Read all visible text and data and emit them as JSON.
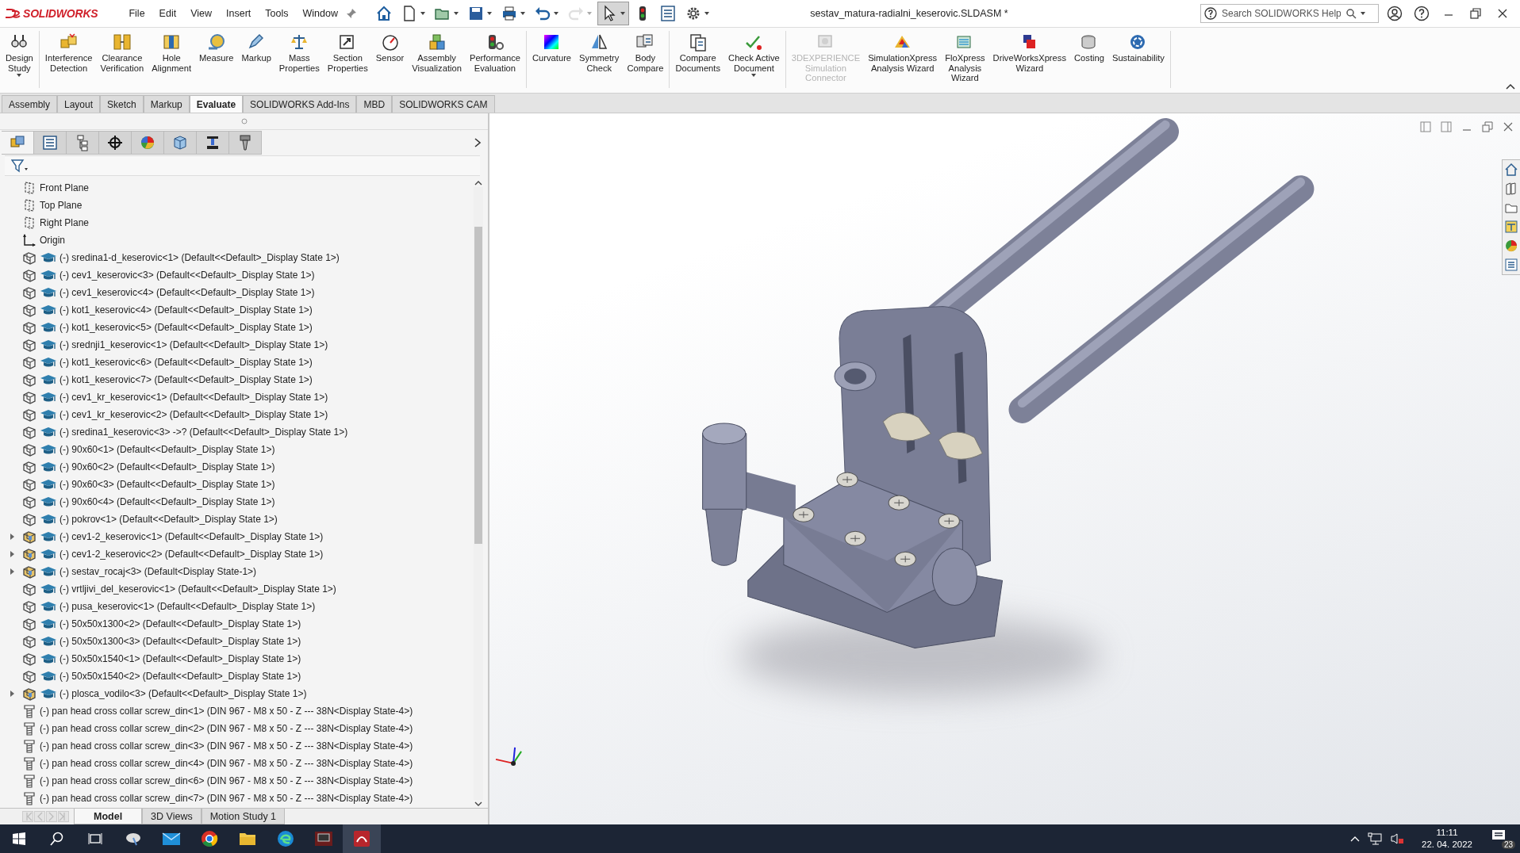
{
  "title_bar": {
    "logo_text": "SOLIDWORKS",
    "menu": [
      "File",
      "Edit",
      "View",
      "Insert",
      "Tools",
      "Window"
    ],
    "quick_access": [
      {
        "selected": false,
        "disabled": false
      },
      {
        "selected": false,
        "disabled": false
      },
      {
        "selected": false,
        "disabled": false
      },
      {
        "selected": false,
        "disabled": false
      },
      {
        "selected": false,
        "disabled": false
      },
      {
        "selected": false,
        "disabled": false
      },
      {
        "selected": false,
        "disabled": true
      },
      {
        "selected": true,
        "disabled": false
      },
      {
        "selected": false,
        "disabled": false
      },
      {
        "selected": false,
        "disabled": false
      },
      {
        "selected": false,
        "disabled": false
      }
    ],
    "document_title": "sestav_matura-radialni_keserovic.SLDASM *",
    "search": {
      "placeholder": "Search SOLIDWORKS Help"
    }
  },
  "ribbon": {
    "groups": [
      {
        "buttons": [
          {
            "label": "Design\nStudy",
            "disabled": false,
            "dropdown": true
          }
        ]
      },
      {
        "buttons": [
          {
            "label": "Interference\nDetection",
            "disabled": false,
            "dropdown": false
          },
          {
            "label": "Clearance\nVerification",
            "disabled": false,
            "dropdown": false
          },
          {
            "label": "Hole\nAlignment",
            "disabled": false,
            "dropdown": false
          },
          {
            "label": "Measure",
            "disabled": false,
            "dropdown": false
          },
          {
            "label": "Markup",
            "disabled": false,
            "dropdown": false
          },
          {
            "label": "Mass\nProperties",
            "disabled": false,
            "dropdown": false
          },
          {
            "label": "Section\nProperties",
            "disabled": false,
            "dropdown": false
          },
          {
            "label": "Sensor",
            "disabled": false,
            "dropdown": false
          },
          {
            "label": "Assembly\nVisualization",
            "disabled": false,
            "dropdown": false
          },
          {
            "label": "Performance\nEvaluation",
            "disabled": false,
            "dropdown": false
          }
        ]
      },
      {
        "buttons": [
          {
            "label": "Curvature",
            "disabled": false,
            "dropdown": false
          },
          {
            "label": "Symmetry\nCheck",
            "disabled": false,
            "dropdown": false
          },
          {
            "label": "Body\nCompare",
            "disabled": false,
            "dropdown": false
          }
        ]
      },
      {
        "buttons": [
          {
            "label": "Compare\nDocuments",
            "disabled": false,
            "dropdown": false
          },
          {
            "label": "Check Active\nDocument",
            "disabled": false,
            "dropdown": true
          }
        ]
      },
      {
        "buttons": [
          {
            "label": "3DEXPERIENCE\nSimulation\nConnector",
            "disabled": true,
            "dropdown": false
          },
          {
            "label": "SimulationXpress\nAnalysis Wizard",
            "disabled": false,
            "dropdown": false
          },
          {
            "label": "FloXpress\nAnalysis\nWizard",
            "disabled": false,
            "dropdown": false
          },
          {
            "label": "DriveWorksXpress\nWizard",
            "disabled": false,
            "dropdown": false
          },
          {
            "label": "Costing",
            "disabled": false,
            "dropdown": false
          },
          {
            "label": "Sustainability",
            "disabled": false,
            "dropdown": false
          }
        ]
      }
    ]
  },
  "command_tabs": [
    {
      "label": "Assembly",
      "selected": false
    },
    {
      "label": "Layout",
      "selected": false
    },
    {
      "label": "Sketch",
      "selected": false
    },
    {
      "label": "Markup",
      "selected": false
    },
    {
      "label": "Evaluate",
      "selected": true
    },
    {
      "label": "SOLIDWORKS Add-Ins",
      "selected": false
    },
    {
      "label": "MBD",
      "selected": false
    },
    {
      "label": "SOLIDWORKS CAM",
      "selected": false
    }
  ],
  "feature_tree": {
    "panel_tabs": [
      {
        "selected": true
      },
      {
        "selected": false
      },
      {
        "selected": false
      },
      {
        "selected": false
      },
      {
        "selected": false
      },
      {
        "selected": false
      },
      {
        "selected": false
      },
      {
        "selected": false
      }
    ],
    "items": [
      {
        "kind": "plane",
        "label": "Front Plane"
      },
      {
        "kind": "plane",
        "label": "Top Plane"
      },
      {
        "kind": "plane",
        "label": "Right Plane"
      },
      {
        "kind": "origin",
        "label": "Origin"
      },
      {
        "kind": "part",
        "label": "(-) sredina1-d_keserovic<1> (Default<<Default>_Display State 1>)"
      },
      {
        "kind": "part",
        "label": "(-) cev1_keserovic<3> (Default<<Default>_Display State 1>)"
      },
      {
        "kind": "part",
        "label": "(-) cev1_keserovic<4> (Default<<Default>_Display State 1>)"
      },
      {
        "kind": "part",
        "label": "(-) kot1_keserovic<4> (Default<<Default>_Display State 1>)"
      },
      {
        "kind": "part",
        "label": "(-) kot1_keserovic<5> (Default<<Default>_Display State 1>)"
      },
      {
        "kind": "part",
        "label": "(-) srednji1_keserovic<1> (Default<<Default>_Display State 1>)"
      },
      {
        "kind": "part",
        "label": "(-) kot1_keserovic<6> (Default<<Default>_Display State 1>)"
      },
      {
        "kind": "part",
        "label": "(-) kot1_keserovic<7> (Default<<Default>_Display State 1>)"
      },
      {
        "kind": "part",
        "label": "(-) cev1_kr_keserovic<1> (Default<<Default>_Display State 1>)"
      },
      {
        "kind": "part",
        "label": "(-) cev1_kr_keserovic<2> (Default<<Default>_Display State 1>)"
      },
      {
        "kind": "part",
        "label": "(-) sredina1_keserovic<3> ->? (Default<<Default>_Display State 1>)"
      },
      {
        "kind": "part",
        "label": "(-) 90x60<1> (Default<<Default>_Display State 1>)"
      },
      {
        "kind": "part",
        "label": "(-) 90x60<2> (Default<<Default>_Display State 1>)"
      },
      {
        "kind": "part",
        "label": "(-) 90x60<3> (Default<<Default>_Display State 1>)"
      },
      {
        "kind": "part",
        "label": "(-) 90x60<4> (Default<<Default>_Display State 1>)"
      },
      {
        "kind": "part",
        "label": "(-) pokrov<1> (Default<<Default>_Display State 1>)"
      },
      {
        "kind": "subassembly",
        "label": "(-) cev1-2_keserovic<1> (Default<<Default>_Display State 1>)"
      },
      {
        "kind": "subassembly",
        "label": "(-) cev1-2_keserovic<2> (Default<<Default>_Display State 1>)"
      },
      {
        "kind": "subassembly",
        "label": "(-) sestav_rocaj<3> (Default<Display State-1>)"
      },
      {
        "kind": "part",
        "label": "(-) vrtljivi_del_keserovic<1> (Default<<Default>_Display State 1>)"
      },
      {
        "kind": "part",
        "label": "(-) pusa_keserovic<1> (Default<<Default>_Display State 1>)"
      },
      {
        "kind": "part",
        "label": "(-) 50x50x1300<2> (Default<<Default>_Display State 1>)"
      },
      {
        "kind": "part",
        "label": "(-) 50x50x1300<3> (Default<<Default>_Display State 1>)"
      },
      {
        "kind": "part",
        "label": "(-) 50x50x1540<1> (Default<<Default>_Display State 1>)"
      },
      {
        "kind": "part",
        "label": "(-) 50x50x1540<2> (Default<<Default>_Display State 1>)"
      },
      {
        "kind": "subassembly",
        "label": "(-) plosca_vodilo<3> (Default<<Default>_Display State 1>)"
      },
      {
        "kind": "screw",
        "label": "(-) pan head cross collar screw_din<1> (DIN 967 - M8 x 50 - Z --- 38N<Display State-4>)"
      },
      {
        "kind": "screw",
        "label": "(-) pan head cross collar screw_din<2> (DIN 967 - M8 x 50 - Z --- 38N<Display State-4>)"
      },
      {
        "kind": "screw",
        "label": "(-) pan head cross collar screw_din<3> (DIN 967 - M8 x 50 - Z --- 38N<Display State-4>)"
      },
      {
        "kind": "screw",
        "label": "(-) pan head cross collar screw_din<4> (DIN 967 - M8 x 50 - Z --- 38N<Display State-4>)"
      },
      {
        "kind": "screw",
        "label": "(-) pan head cross collar screw_din<6> (DIN 967 - M8 x 50 - Z --- 38N<Display State-4>)"
      },
      {
        "kind": "screw",
        "label": "(-) pan head cross collar screw_din<7> (DIN 967 - M8 x 50 - Z --- 38N<Display State-4>)"
      }
    ]
  },
  "bottom_tabs": [
    {
      "label": "Model",
      "selected": true
    },
    {
      "label": "3D Views",
      "selected": false
    },
    {
      "label": "Motion Study 1",
      "selected": false
    }
  ],
  "taskbar": {
    "time": "11:11",
    "date": "22. 04. 2022",
    "notification_count": "23"
  }
}
